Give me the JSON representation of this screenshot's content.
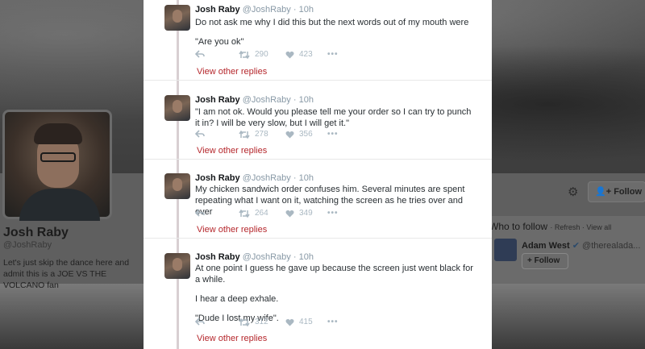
{
  "profile": {
    "name": "Josh Raby",
    "handle": "@JoshRaby",
    "bio": "Let's just skip the dance here and admit this is a JOE VS THE VOLCANO fan"
  },
  "profile_actions": {
    "follow_label": "Follow"
  },
  "who_to_follow": {
    "title": "Who to follow",
    "refresh": "Refresh",
    "view_all": "View all",
    "suggestion": {
      "name": "Adam West",
      "handle": "@therealada...",
      "follow_label": "Follow"
    }
  },
  "tweets": [
    {
      "name": "Josh Raby",
      "handle": "@JoshRaby",
      "time": "10h",
      "lines": [
        "Do not ask me why I did this but the next words out of my mouth were",
        "\"Are you ok\""
      ],
      "retweets": "290",
      "likes": "423",
      "view_replies": "View other replies"
    },
    {
      "name": "Josh Raby",
      "handle": "@JoshRaby",
      "time": "10h",
      "lines": [
        "\"I am not ok. Would you please tell me your order so I can try to punch it in? I will be very slow, but I will get it.\""
      ],
      "retweets": "278",
      "likes": "356",
      "view_replies": "View other replies"
    },
    {
      "name": "Josh Raby",
      "handle": "@JoshRaby",
      "time": "10h",
      "lines": [
        "My chicken sandwich order confuses him. Several minutes are spent repeating what I want on it, watching the screen as he tries over and over"
      ],
      "retweets": "264",
      "likes": "349",
      "view_replies": "View other replies"
    },
    {
      "name": "Josh Raby",
      "handle": "@JoshRaby",
      "time": "10h",
      "lines": [
        "At one point I guess he gave up because the screen just went black for a while.",
        "I hear a deep exhale.",
        "\"Dude I lost my wife\"."
      ],
      "retweets": "312",
      "likes": "415",
      "view_replies": "View other replies"
    }
  ],
  "colors": {
    "link_red": "#b5272c",
    "muted": "#8899a6",
    "icon": "#aab8c2"
  },
  "icons": [
    "reply-icon",
    "retweet-icon",
    "like-icon",
    "more-icon",
    "gear-icon",
    "add-user-icon",
    "verified-icon"
  ]
}
